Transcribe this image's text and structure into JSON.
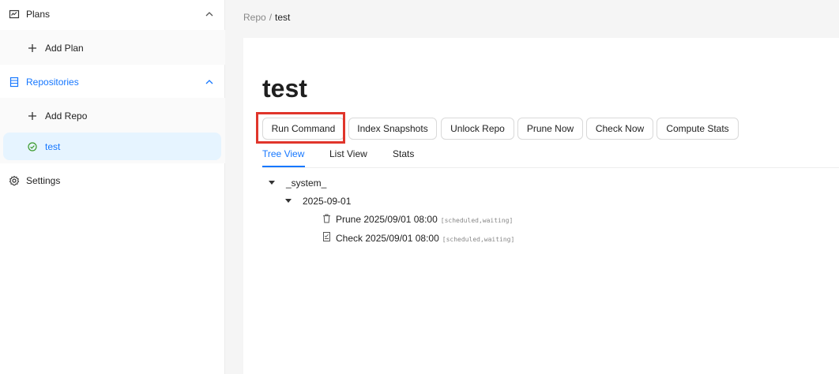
{
  "sidebar": {
    "plans": {
      "label": "Plans",
      "icon": "dashboard-icon"
    },
    "add_plan": {
      "label": "Add Plan",
      "icon": "plus-icon"
    },
    "repositories": {
      "label": "Repositories",
      "icon": "database-icon"
    },
    "add_repo": {
      "label": "Add Repo",
      "icon": "plus-icon"
    },
    "repo_test": {
      "label": "test",
      "icon": "check-circle-icon",
      "status_color": "#52c41a"
    },
    "settings": {
      "label": "Settings",
      "icon": "gear-icon"
    }
  },
  "breadcrumb": {
    "parent": "Repo",
    "separator": "/",
    "current": "test"
  },
  "page": {
    "title": "test"
  },
  "actions": {
    "run_command": "Run Command",
    "index_snapshots": "Index Snapshots",
    "unlock_repo": "Unlock Repo",
    "prune_now": "Prune Now",
    "check_now": "Check Now",
    "compute_stats": "Compute Stats"
  },
  "tabs": [
    {
      "label": "Tree View",
      "active": true
    },
    {
      "label": "List View",
      "active": false
    },
    {
      "label": "Stats",
      "active": false
    }
  ],
  "tree": {
    "root": "_system_",
    "date": "2025-09-01",
    "items": [
      {
        "label": "Prune 2025/09/01 08:00",
        "meta": "[scheduled,waiting]",
        "icon": "trash-icon"
      },
      {
        "label": "Check 2025/09/01 08:00",
        "meta": "[scheduled,waiting]",
        "icon": "check-document-icon"
      }
    ]
  },
  "colors": {
    "accent": "#1677ff",
    "highlight": "#e0352b",
    "selected_bg": "#e6f4ff"
  }
}
